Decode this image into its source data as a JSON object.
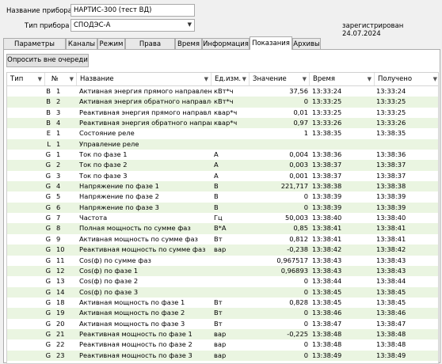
{
  "device": {
    "name_label": "Название прибора",
    "name_value": "НАРТИС-300 (тест ВД)",
    "type_label": "Тип прибора",
    "type_value": "СПОДЭС-А",
    "registered": "зарегистрирован 24.07.2024"
  },
  "tabs": [
    "Параметры связи",
    "Каналы",
    "Режим",
    "Права доступа",
    "Время",
    "Информация",
    "Показания",
    "Архивы"
  ],
  "active_tab": "Показания",
  "poll_button": "Опросить вне очереди",
  "columns": {
    "type": "Тип",
    "num": "№",
    "name": "Название",
    "unit": "Ед.изм.",
    "value": "Значение",
    "time": "Время",
    "received": "Получено"
  },
  "rows": [
    {
      "code": "B",
      "num": "1",
      "name": "Активная энергия прямого направления",
      "unit": "кВт*ч",
      "value": "37,56",
      "time": "13:33:24",
      "recv": "13:33:24"
    },
    {
      "code": "B",
      "num": "2",
      "name": "Активная энергия обратного направле...",
      "unit": "кВт*ч",
      "value": "0",
      "time": "13:33:25",
      "recv": "13:33:25"
    },
    {
      "code": "B",
      "num": "3",
      "name": "Реактивная энергия прямого направле...",
      "unit": "квар*ч",
      "value": "0,01",
      "time": "13:33:25",
      "recv": "13:33:25"
    },
    {
      "code": "B",
      "num": "4",
      "name": "Реактивная энергия обратного направ...",
      "unit": "квар*ч",
      "value": "0,97",
      "time": "13:33:26",
      "recv": "13:33:26"
    },
    {
      "code": "E",
      "num": "1",
      "name": "Состояние реле",
      "unit": "",
      "value": "1",
      "time": "13:38:35",
      "recv": "13:38:35"
    },
    {
      "code": "L",
      "num": "1",
      "name": "Управление реле",
      "unit": "",
      "value": "",
      "time": "",
      "recv": ""
    },
    {
      "code": "G",
      "num": "1",
      "name": "Ток по фазе 1",
      "unit": "А",
      "value": "0,004",
      "time": "13:38:36",
      "recv": "13:38:36"
    },
    {
      "code": "G",
      "num": "2",
      "name": "Ток по фазе 2",
      "unit": "А",
      "value": "0,003",
      "time": "13:38:37",
      "recv": "13:38:37"
    },
    {
      "code": "G",
      "num": "3",
      "name": "Ток по фазе 3",
      "unit": "А",
      "value": "0,001",
      "time": "13:38:37",
      "recv": "13:38:37"
    },
    {
      "code": "G",
      "num": "4",
      "name": "Напряжение по фазе 1",
      "unit": "В",
      "value": "221,717",
      "time": "13:38:38",
      "recv": "13:38:38"
    },
    {
      "code": "G",
      "num": "5",
      "name": "Напряжение по фазе 2",
      "unit": "В",
      "value": "0",
      "time": "13:38:39",
      "recv": "13:38:39"
    },
    {
      "code": "G",
      "num": "6",
      "name": "Напряжение по фазе 3",
      "unit": "В",
      "value": "0",
      "time": "13:38:39",
      "recv": "13:38:39"
    },
    {
      "code": "G",
      "num": "7",
      "name": "Частота",
      "unit": "Гц",
      "value": "50,003",
      "time": "13:38:40",
      "recv": "13:38:40"
    },
    {
      "code": "G",
      "num": "8",
      "name": "Полная мощность по сумме фаз",
      "unit": "В*А",
      "value": "0,85",
      "time": "13:38:41",
      "recv": "13:38:41"
    },
    {
      "code": "G",
      "num": "9",
      "name": "Активная мощность по сумме фаз",
      "unit": "Вт",
      "value": "0,812",
      "time": "13:38:41",
      "recv": "13:38:41"
    },
    {
      "code": "G",
      "num": "10",
      "name": "Реактивная мощность по сумме фаз",
      "unit": "вар",
      "value": "-0,238",
      "time": "13:38:42",
      "recv": "13:38:42"
    },
    {
      "code": "G",
      "num": "11",
      "name": "Cos(ф) по сумме фаз",
      "unit": "",
      "value": "0,967517",
      "time": "13:38:43",
      "recv": "13:38:43"
    },
    {
      "code": "G",
      "num": "12",
      "name": "Cos(ф) по фазе 1",
      "unit": "",
      "value": "0,96893",
      "time": "13:38:43",
      "recv": "13:38:43"
    },
    {
      "code": "G",
      "num": "13",
      "name": "Cos(ф) по фазе 2",
      "unit": "",
      "value": "0",
      "time": "13:38:44",
      "recv": "13:38:44"
    },
    {
      "code": "G",
      "num": "14",
      "name": "Cos(ф) по фазе 3",
      "unit": "",
      "value": "0",
      "time": "13:38:45",
      "recv": "13:38:45"
    },
    {
      "code": "G",
      "num": "18",
      "name": "Активная мощность по фазе 1",
      "unit": "Вт",
      "value": "0,828",
      "time": "13:38:45",
      "recv": "13:38:45"
    },
    {
      "code": "G",
      "num": "19",
      "name": "Активная мощность по фазе 2",
      "unit": "Вт",
      "value": "0",
      "time": "13:38:46",
      "recv": "13:38:46"
    },
    {
      "code": "G",
      "num": "20",
      "name": "Активная мощность по фазе 3",
      "unit": "Вт",
      "value": "0",
      "time": "13:38:47",
      "recv": "13:38:47"
    },
    {
      "code": "G",
      "num": "21",
      "name": "Реактивная мощность по фазе 1",
      "unit": "вар",
      "value": "-0,225",
      "time": "13:38:48",
      "recv": "13:38:48"
    },
    {
      "code": "G",
      "num": "22",
      "name": "Реактивная мощность по фазе 2",
      "unit": "вар",
      "value": "0",
      "time": "13:38:48",
      "recv": "13:38:48"
    },
    {
      "code": "G",
      "num": "23",
      "name": "Реактивная мощность по фазе 3",
      "unit": "вар",
      "value": "0",
      "time": "13:38:49",
      "recv": "13:38:49"
    }
  ]
}
